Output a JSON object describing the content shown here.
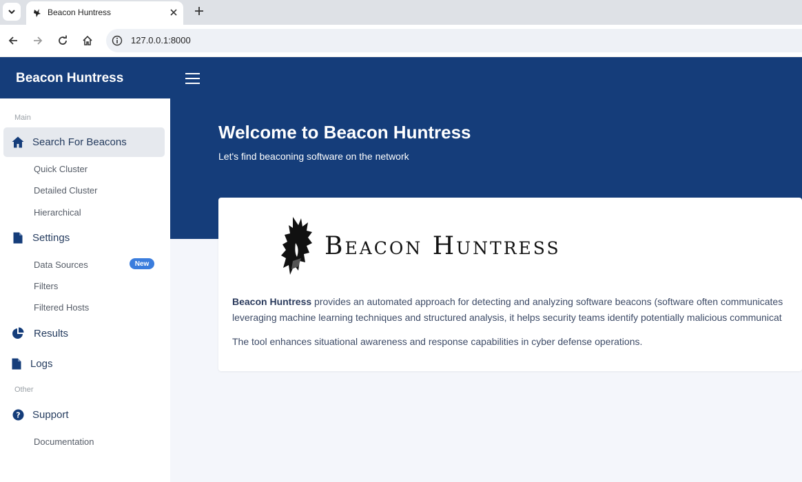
{
  "browser": {
    "tab_title": "Beacon Huntress",
    "url": "127.0.0.1:8000"
  },
  "sidebar": {
    "brand": "Beacon Huntress",
    "section_main": "Main",
    "section_other": "Other",
    "items": [
      {
        "label": "Search For Beacons",
        "icon": "home-icon"
      },
      {
        "label": "Quick Cluster"
      },
      {
        "label": "Detailed Cluster"
      },
      {
        "label": "Hierarchical"
      },
      {
        "label": "Settings",
        "icon": "file-icon"
      },
      {
        "label": "Data Sources",
        "badge": "New"
      },
      {
        "label": "Filters"
      },
      {
        "label": "Filtered Hosts"
      },
      {
        "label": "Results",
        "icon": "pie-chart-icon"
      },
      {
        "label": "Logs",
        "icon": "file-icon"
      },
      {
        "label": "Support",
        "icon": "question-circle-icon"
      },
      {
        "label": "Documentation"
      }
    ]
  },
  "hero": {
    "title": "Welcome to Beacon Huntress",
    "subtitle": "Let's find beaconing software on the network"
  },
  "card": {
    "logo_text": "Beacon Huntress",
    "desc_strong": "Beacon Huntress",
    "desc_line1_rest": " provides an automated approach for detecting and analyzing software beacons (software often communicates",
    "desc_line2": "leveraging machine learning techniques and structured analysis, it helps security teams identify potentially malicious communicat",
    "desc2": "The tool enhances situational awareness and response capabilities in cyber defense operations."
  },
  "colors": {
    "primary": "#153d7a",
    "badge": "#3b7ddd",
    "active_bg": "#e6e9ee"
  }
}
